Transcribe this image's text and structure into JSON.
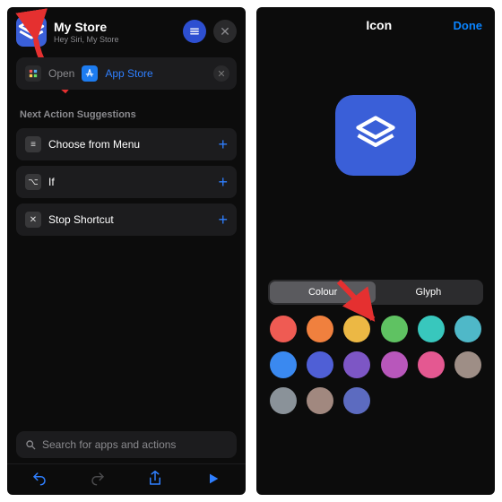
{
  "left": {
    "title": "My Store",
    "subtitle": "Hey Siri, My Store",
    "open_action": {
      "prefix": "Open",
      "app": "App Store"
    },
    "suggestions_head": "Next Action Suggestions",
    "suggestions": [
      {
        "glyph": "≡",
        "label": "Choose from Menu"
      },
      {
        "glyph": "⌥",
        "label": "If"
      },
      {
        "glyph": "✕",
        "label": "Stop Shortcut"
      }
    ],
    "search_placeholder": "Search for apps and actions",
    "icons": {
      "app_tile": "layers-icon",
      "menu": "menu-lines-icon",
      "close": "close-icon",
      "grid": "grid-icon",
      "undo": "undo-icon",
      "redo": "redo-icon",
      "share": "share-icon",
      "run": "play-icon",
      "search": "search-icon"
    }
  },
  "right": {
    "title": "Icon",
    "done": "Done",
    "tabs": {
      "colour": "Colour",
      "glyph": "Glyph",
      "active": "colour"
    },
    "preview_colour": "#3a5fd8",
    "swatches": [
      "#ef5b53",
      "#f0803e",
      "#ecb844",
      "#5fc262",
      "#38c7bd",
      "#4fb8c8",
      "#3a89f0",
      "#4f5fd6",
      "#7d56c5",
      "#b857bb",
      "#e45891",
      "#9e8e86",
      "#8a9299",
      "#a1887f",
      "#5c6bc0"
    ]
  }
}
